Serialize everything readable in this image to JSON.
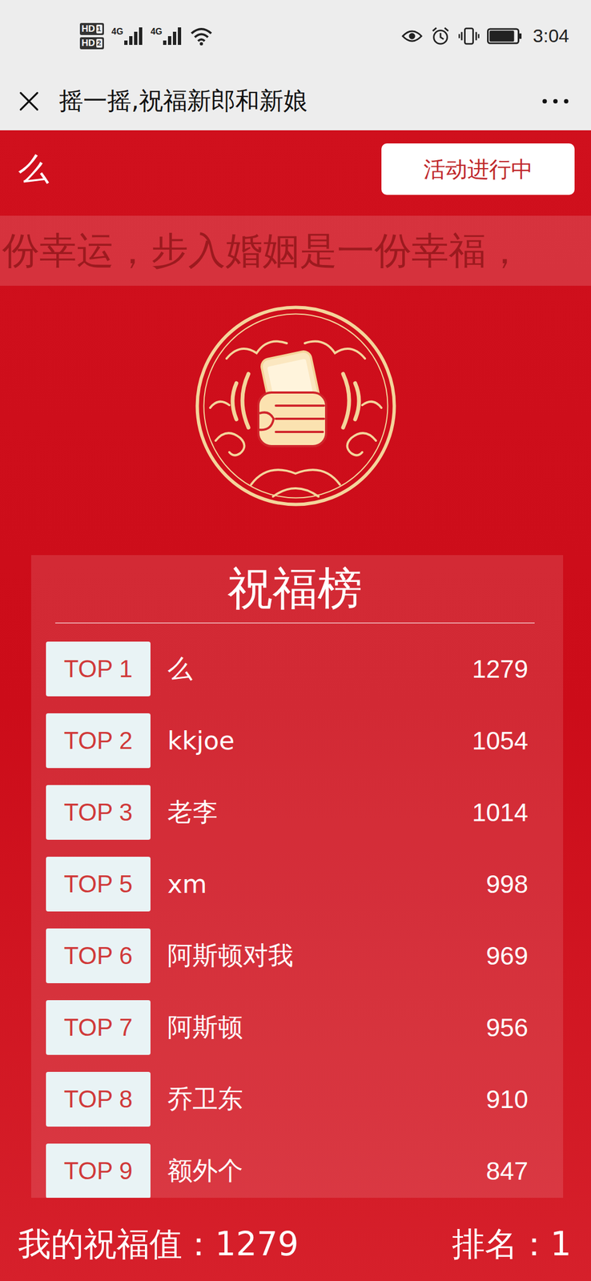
{
  "status_bar": {
    "hd_badges": [
      {
        "text": "HD",
        "sim": "1"
      },
      {
        "text": "HD",
        "sim": "2"
      }
    ],
    "networks": [
      {
        "label": "4G",
        "level": 1
      },
      {
        "label": "4G",
        "level": 1
      }
    ],
    "wifi_level": 1,
    "battery_level": 0.9,
    "time": "3:04"
  },
  "title_bar": {
    "title": "摇一摇,祝福新郎和新娘"
  },
  "header": {
    "user": "么",
    "status_button": "活动进行中"
  },
  "marquee": {
    "text": "份幸运，步入婚姻是一份幸福，"
  },
  "leaderboard": {
    "title": "祝福榜",
    "rows": [
      {
        "rank": "TOP 1",
        "name": "么",
        "score": "1279"
      },
      {
        "rank": "TOP 2",
        "name": "kkjoe",
        "score": "1054"
      },
      {
        "rank": "TOP 3",
        "name": "老李",
        "score": "1014"
      },
      {
        "rank": "TOP 5",
        "name": "xm",
        "score": "998"
      },
      {
        "rank": "TOP 6",
        "name": "阿斯顿对我",
        "score": "969"
      },
      {
        "rank": "TOP 7",
        "name": "阿斯顿",
        "score": "956"
      },
      {
        "rank": "TOP 8",
        "name": "乔卫东",
        "score": "910"
      },
      {
        "rank": "TOP 9",
        "name": "额外个",
        "score": "847"
      }
    ]
  },
  "footer": {
    "my_value": "我的祝福值：1279",
    "rank": "排名：1"
  }
}
